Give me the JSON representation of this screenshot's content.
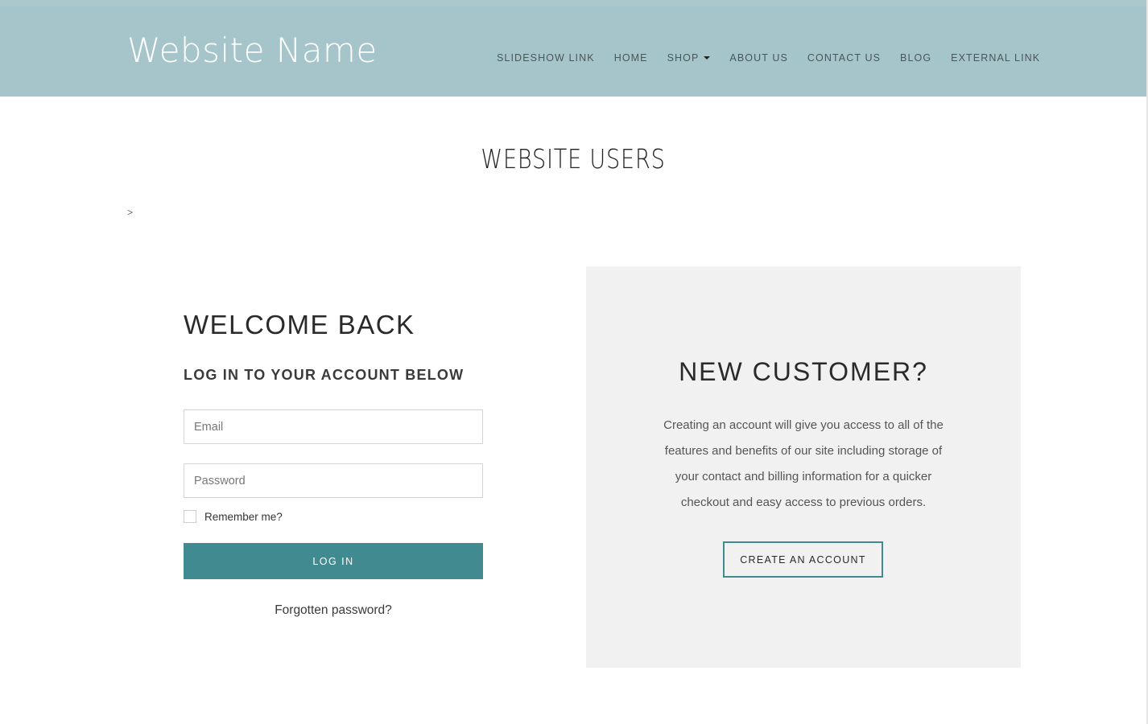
{
  "header": {
    "site_name": "Website Name",
    "nav": [
      {
        "label": "SLIDESHOW LINK"
      },
      {
        "label": "HOME"
      },
      {
        "label": "SHOP",
        "has_dropdown": true
      },
      {
        "label": "ABOUT US"
      },
      {
        "label": "CONTACT US"
      },
      {
        "label": "BLOG"
      },
      {
        "label": "EXTERNAL LINK"
      }
    ]
  },
  "page": {
    "title": "WEBSITE USERS",
    "breadcrumb": ">"
  },
  "login": {
    "heading": "WELCOME BACK",
    "subheading": "LOG IN TO YOUR ACCOUNT BELOW",
    "email_placeholder": "Email",
    "email_value": "",
    "password_placeholder": "Password",
    "password_value": "",
    "remember_label": "Remember me?",
    "remember_checked": false,
    "submit_label": "LOG IN",
    "forgot_label": "Forgotten password?"
  },
  "new_customer": {
    "heading": "NEW CUSTOMER?",
    "description": "Creating an account will give you access to all of the features and benefits of our site including storage of your contact and billing information for a quicker checkout and easy access to previous orders.",
    "button_label": "CREATE AN ACCOUNT"
  },
  "colors": {
    "header_bg": "#a5c5ca",
    "accent": "#418a90",
    "panel_bg": "#f1f1f1"
  }
}
